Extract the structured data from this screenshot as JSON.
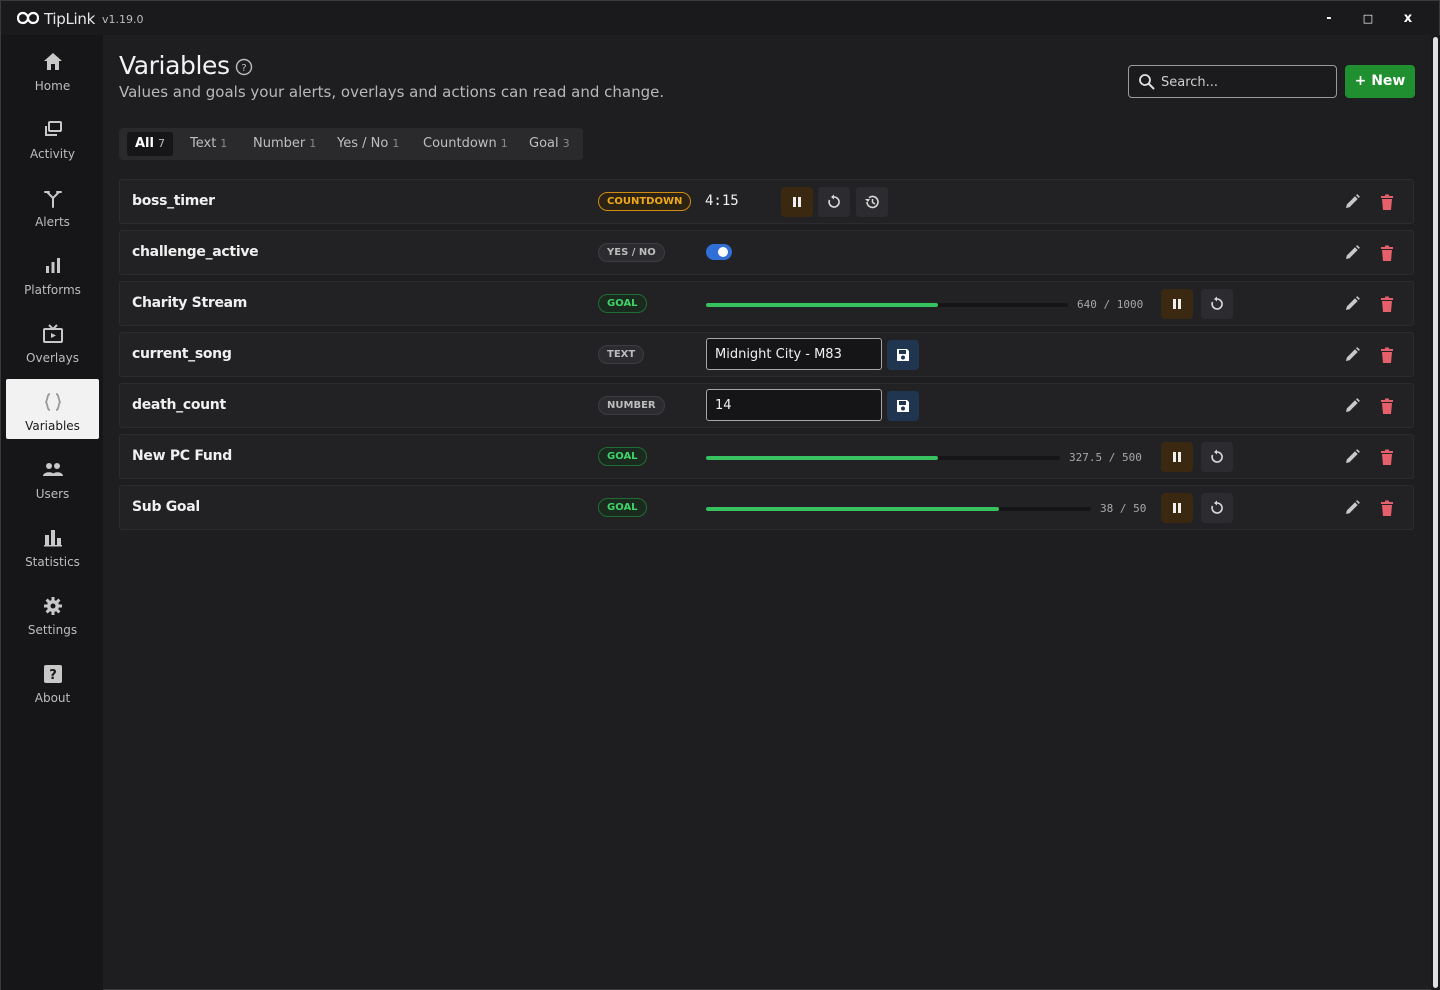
{
  "app": {
    "name": "TipLink",
    "version": "v1.19.0"
  },
  "window_controls": {
    "minimize": "-",
    "maximize": "□",
    "close": "x"
  },
  "sidebar": {
    "items": [
      {
        "label": "Home",
        "icon": "home-icon",
        "active": false
      },
      {
        "label": "Activity",
        "icon": "activity-icon",
        "active": false
      },
      {
        "label": "Alerts",
        "icon": "alerts-icon",
        "active": false
      },
      {
        "label": "Platforms",
        "icon": "platforms-icon",
        "active": false
      },
      {
        "label": "Overlays",
        "icon": "overlays-icon",
        "active": false
      },
      {
        "label": "Variables",
        "icon": "variables-icon",
        "active": true
      },
      {
        "label": "Users",
        "icon": "users-icon",
        "active": false
      },
      {
        "label": "Statistics",
        "icon": "statistics-icon",
        "active": false
      },
      {
        "label": "Settings",
        "icon": "settings-icon",
        "active": false
      },
      {
        "label": "About",
        "icon": "about-icon",
        "active": false
      }
    ]
  },
  "header": {
    "title": "Variables",
    "subtitle": "Values and goals your alerts, overlays and actions can read and change.",
    "search_placeholder": "Search...",
    "new_button": "New"
  },
  "tabs": [
    {
      "label": "All",
      "count": "7",
      "active": true
    },
    {
      "label": "Text",
      "count": "1",
      "active": false
    },
    {
      "label": "Number",
      "count": "1",
      "active": false
    },
    {
      "label": "Yes / No",
      "count": "1",
      "active": false
    },
    {
      "label": "Countdown",
      "count": "1",
      "active": false
    },
    {
      "label": "Goal",
      "count": "3",
      "active": false
    }
  ],
  "variables": [
    {
      "name": "boss_timer",
      "type": "COUNTDOWN",
      "value": "4:15"
    },
    {
      "name": "challenge_active",
      "type": "YES / NO",
      "value": true
    },
    {
      "name": "Charity Stream",
      "type": "GOAL",
      "current": "640",
      "target": "1000",
      "progress": 0.64
    },
    {
      "name": "current_song",
      "type": "TEXT",
      "value": "Midnight City - M83"
    },
    {
      "name": "death_count",
      "type": "NUMBER",
      "value": "14"
    },
    {
      "name": "New PC Fund",
      "type": "GOAL",
      "current": "327.5",
      "target": "500",
      "progress": 0.655
    },
    {
      "name": "Sub Goal",
      "type": "GOAL",
      "current": "38",
      "target": "50",
      "progress": 0.76
    }
  ],
  "colors": {
    "accent_green": "#36c25e",
    "new_button": "#1f8f2f",
    "countdown_orange": "#f0a81c",
    "toggle_blue": "#2f6fd6",
    "delete_red": "#e5606a"
  }
}
